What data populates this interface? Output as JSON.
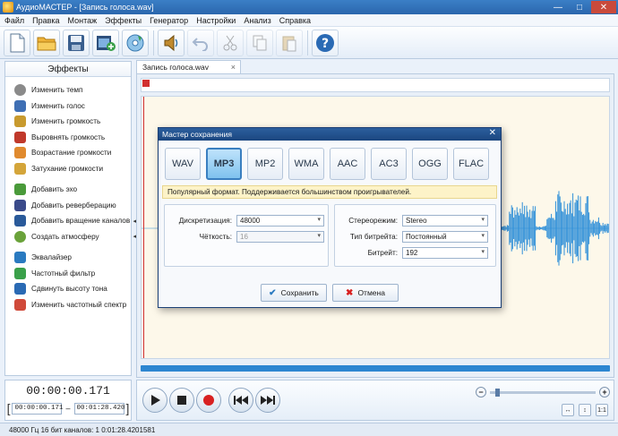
{
  "window": {
    "title": "АудиоМАСТЕР - [Запись голоса.wav]",
    "minimize": "—",
    "maximize": "□",
    "close": "✕"
  },
  "menu": [
    "Файл",
    "Правка",
    "Монтаж",
    "Эффекты",
    "Генератор",
    "Настройки",
    "Анализ",
    "Справка"
  ],
  "toolbar": {
    "buttons": [
      {
        "name": "new-file-icon",
        "enabled": true
      },
      {
        "name": "open-folder-icon",
        "enabled": true
      },
      {
        "name": "save-disk-icon",
        "enabled": true
      },
      {
        "name": "import-video-icon",
        "enabled": true
      },
      {
        "name": "record-cd-icon",
        "enabled": true
      },
      {
        "name": "play-selection-icon",
        "enabled": true
      },
      {
        "name": "undo-icon",
        "enabled": false
      },
      {
        "name": "cut-icon",
        "enabled": false
      },
      {
        "name": "copy-icon",
        "enabled": false
      },
      {
        "name": "paste-icon",
        "enabled": false
      },
      {
        "name": "help-icon",
        "enabled": true
      }
    ]
  },
  "effects_panel": {
    "title": "Эффекты",
    "items": [
      {
        "label": "Изменить темп",
        "icon": "tempo-icon",
        "color": "#8a8a8a"
      },
      {
        "label": "Изменить голос",
        "icon": "voice-icon",
        "color": "#3f6fb4"
      },
      {
        "label": "Изменить громкость",
        "icon": "volume-icon",
        "color": "#c89a2e"
      },
      {
        "label": "Выровнять громкость",
        "icon": "normalize-icon",
        "color": "#c0392b"
      },
      {
        "label": "Возрастание громкости",
        "icon": "fade-in-icon",
        "color": "#e08a2e"
      },
      {
        "label": "Затухание громкости",
        "icon": "fade-out-icon",
        "color": "#d4a53a"
      },
      {
        "label": "Добавить эхо",
        "icon": "echo-icon",
        "color": "#4a9a3a"
      },
      {
        "label": "Добавить реверберацию",
        "icon": "reverb-icon",
        "color": "#3a4a8a"
      },
      {
        "label": "Добавить вращение каналов",
        "icon": "rotate-channels-icon",
        "color": "#2a5a9a",
        "arrow": "◂"
      },
      {
        "label": "Создать атмосферу",
        "icon": "atmosphere-icon",
        "color": "#6aa23a",
        "arrow": "◂"
      },
      {
        "label": "Эквалайзер",
        "icon": "equalizer-icon",
        "color": "#2a7ac0"
      },
      {
        "label": "Частотный фильтр",
        "icon": "frequency-filter-icon",
        "color": "#3aa04a"
      },
      {
        "label": "Сдвинуть высоту тона",
        "icon": "pitch-shift-icon",
        "color": "#2a6ab4"
      },
      {
        "label": "Изменить частотный спектр",
        "icon": "spectrum-icon",
        "color": "#d04a3a"
      }
    ]
  },
  "file_tab": {
    "label": "Запись голоса.wav",
    "close": "×"
  },
  "dialog": {
    "title": "Мастер сохранения",
    "close": "✕",
    "formats": [
      "WAV",
      "MP3",
      "MP2",
      "WMA",
      "AAC",
      "AC3",
      "OGG",
      "FLAC"
    ],
    "selected_format": "MP3",
    "hint": "Популярный формат. Поддерживается большинством проигрывателей.",
    "sampling_label": "Дискретизация:",
    "sampling_value": "48000",
    "clarity_label": "Чёткость:",
    "clarity_value": "16",
    "stereo_label": "Стереорежим:",
    "stereo_value": "Stereo",
    "bitrate_type_label": "Тип битрейта:",
    "bitrate_type_value": "Постоянный",
    "bitrate_label": "Битрейт:",
    "bitrate_value": "192",
    "save_button": "Сохранить",
    "cancel_button": "Отмена"
  },
  "time": {
    "current": "00:00:00.171",
    "selection_start": "00:00:00.171",
    "selection_end": "00:01:28.420",
    "dash": "–"
  },
  "zoom": {
    "minus": "−",
    "plus": "+",
    "level": 0.05
  },
  "view_buttons": [
    "↔",
    "↕",
    "1:1"
  ],
  "status": "48000 Гц  16 бит  каналов: 1   0:01:28.4201581"
}
